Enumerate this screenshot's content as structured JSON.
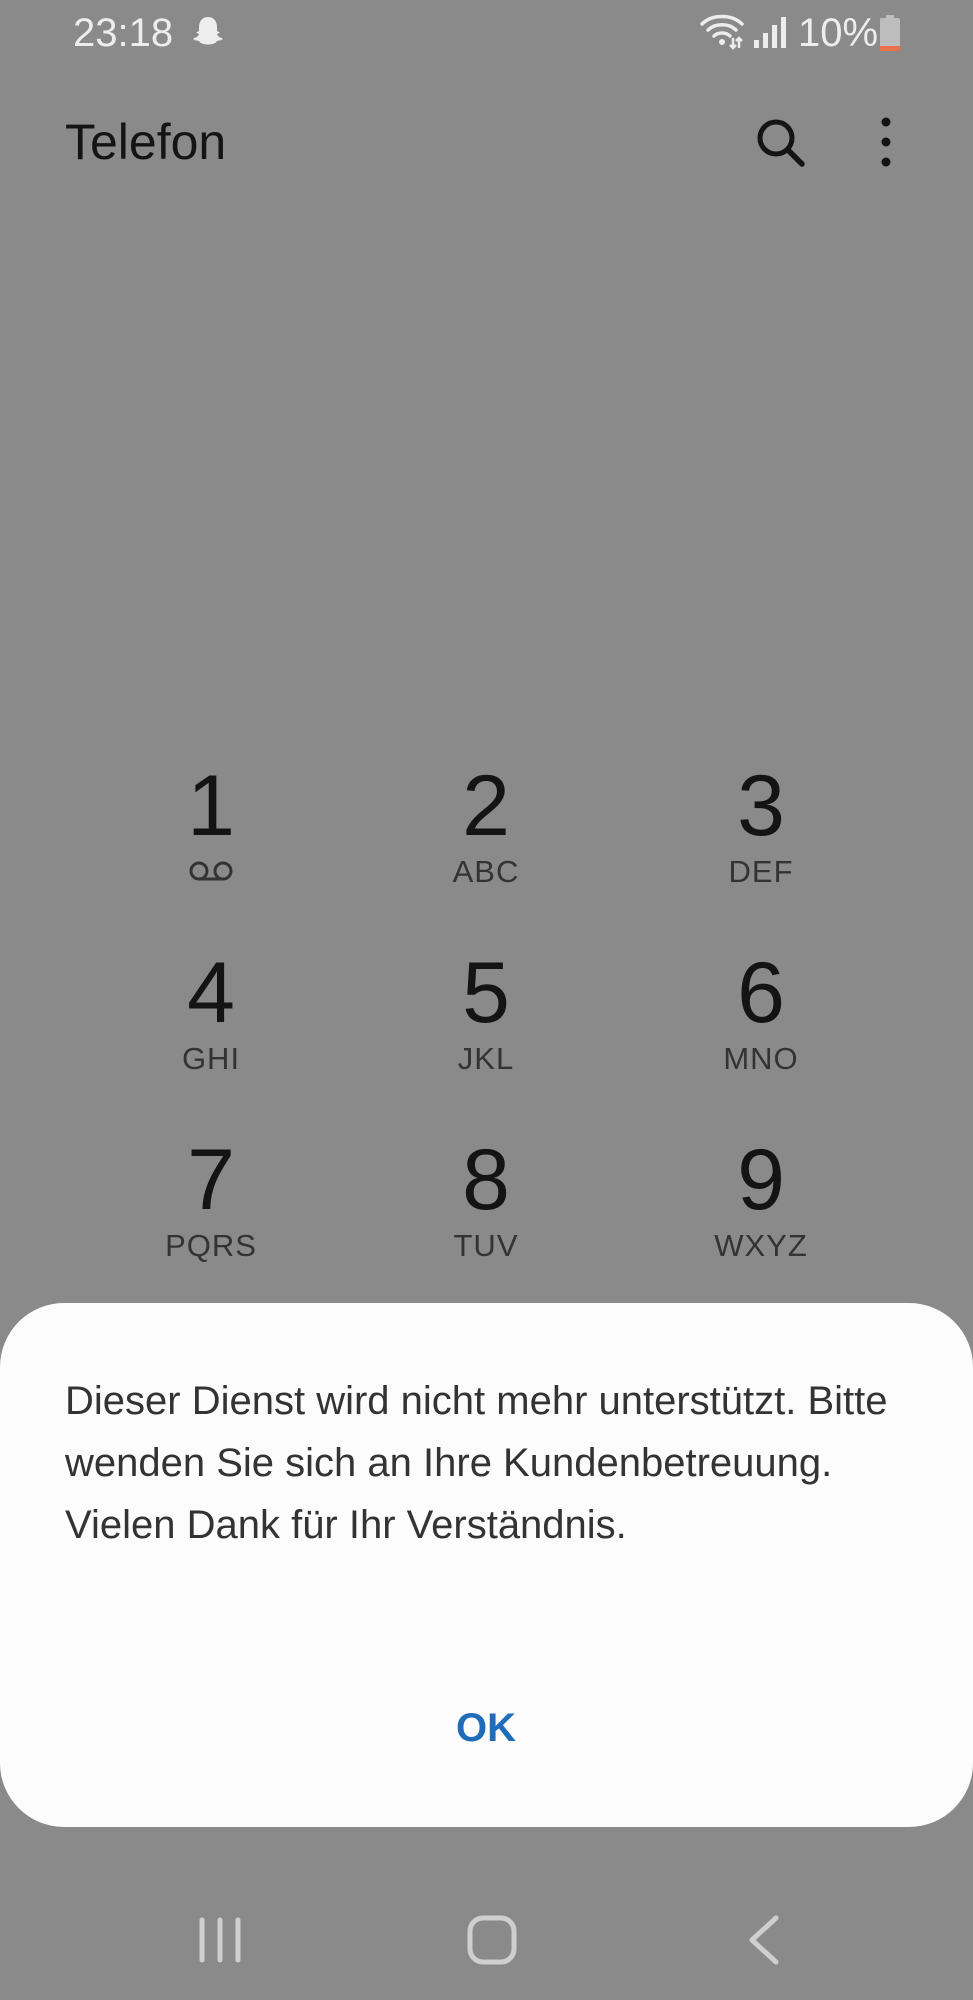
{
  "status_bar": {
    "time": "23:18",
    "battery_percent": "10%",
    "icons": [
      "ghost-icon",
      "wifi-icon",
      "signal-icon",
      "battery-icon"
    ]
  },
  "app_bar": {
    "title": "Telefon",
    "actions": [
      "search-icon",
      "more-vert-icon"
    ]
  },
  "keypad": {
    "keys": [
      {
        "digit": "1",
        "letters": "",
        "icon": "voicemail-icon"
      },
      {
        "digit": "2",
        "letters": "ABC"
      },
      {
        "digit": "3",
        "letters": "DEF"
      },
      {
        "digit": "4",
        "letters": "GHI"
      },
      {
        "digit": "5",
        "letters": "JKL"
      },
      {
        "digit": "6",
        "letters": "MNO"
      },
      {
        "digit": "7",
        "letters": "PQRS"
      },
      {
        "digit": "8",
        "letters": "TUV"
      },
      {
        "digit": "9",
        "letters": "WXYZ"
      }
    ]
  },
  "dialog": {
    "message": "Dieser Dienst wird nicht mehr unterstützt. Bitte wenden Sie sich an Ihre Kundenbetreuung. Vielen Dank für Ihr Verständnis.",
    "ok_label": "OK"
  },
  "nav_bar": {
    "buttons": [
      "recent-apps-icon",
      "home-icon",
      "back-icon"
    ]
  },
  "colors": {
    "scrim_background": "#8a8a8a",
    "dialog_background": "#fcfcfc",
    "accent": "#1f6db8",
    "battery_low": "#e8734a"
  }
}
